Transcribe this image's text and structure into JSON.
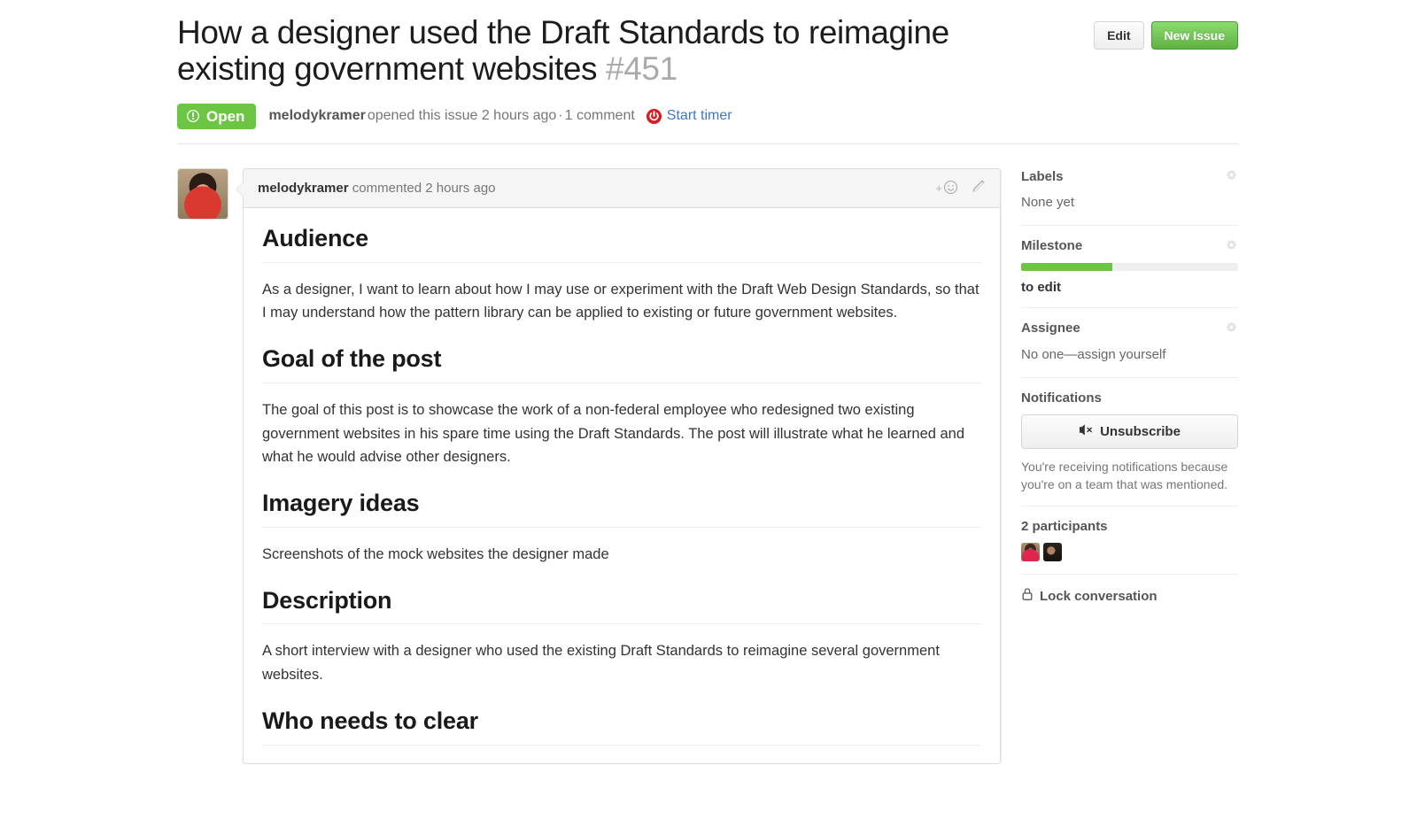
{
  "header": {
    "title": "How a designer used the Draft Standards to reimagine existing government websites",
    "issue_number": "#451",
    "edit_label": "Edit",
    "new_issue_label": "New Issue"
  },
  "meta": {
    "state": "Open",
    "author": "melodykramer",
    "opened_text": "opened this issue 2 hours ago",
    "separator": "·",
    "comment_count": "1 comment",
    "timer_label": "Start timer"
  },
  "comment": {
    "author": "melodykramer",
    "action": "commented 2 hours ago",
    "add_reaction": "+",
    "sections": [
      {
        "heading": "Audience",
        "paragraph": "As a designer, I want to learn about how I may use or experiment with the Draft Web Design Standards, so that I may understand how the pattern library can be applied to existing or future government websites."
      },
      {
        "heading": "Goal of the post",
        "paragraph": "The goal of this post is to showcase the work of a non-federal employee who redesigned two existing government websites in his spare time using the Draft Standards. The post will illustrate what he learned and what he would advise other designers."
      },
      {
        "heading": "Imagery ideas",
        "paragraph": "Screenshots of the mock websites the designer made"
      },
      {
        "heading": "Description",
        "paragraph": "A short interview with a designer who used the existing Draft Standards to reimagine several government websites."
      },
      {
        "heading": "Who needs to clear",
        "paragraph": ""
      }
    ]
  },
  "sidebar": {
    "labels": {
      "title": "Labels",
      "value": "None yet"
    },
    "milestone": {
      "title": "Milestone",
      "progress_percent": 42,
      "name": "to edit"
    },
    "assignee": {
      "title": "Assignee",
      "value": "No one—assign yourself"
    },
    "notifications": {
      "title": "Notifications",
      "button_label": "Unsubscribe",
      "note": "You're receiving notifications because you're on a team that was mentioned."
    },
    "participants": {
      "title": "2 participants"
    },
    "lock": {
      "label": "Lock conversation"
    }
  },
  "colors": {
    "open_green": "#6cc644",
    "link_blue": "#4078c0",
    "timer_red": "#d91c24",
    "button_green": "#60b044"
  }
}
